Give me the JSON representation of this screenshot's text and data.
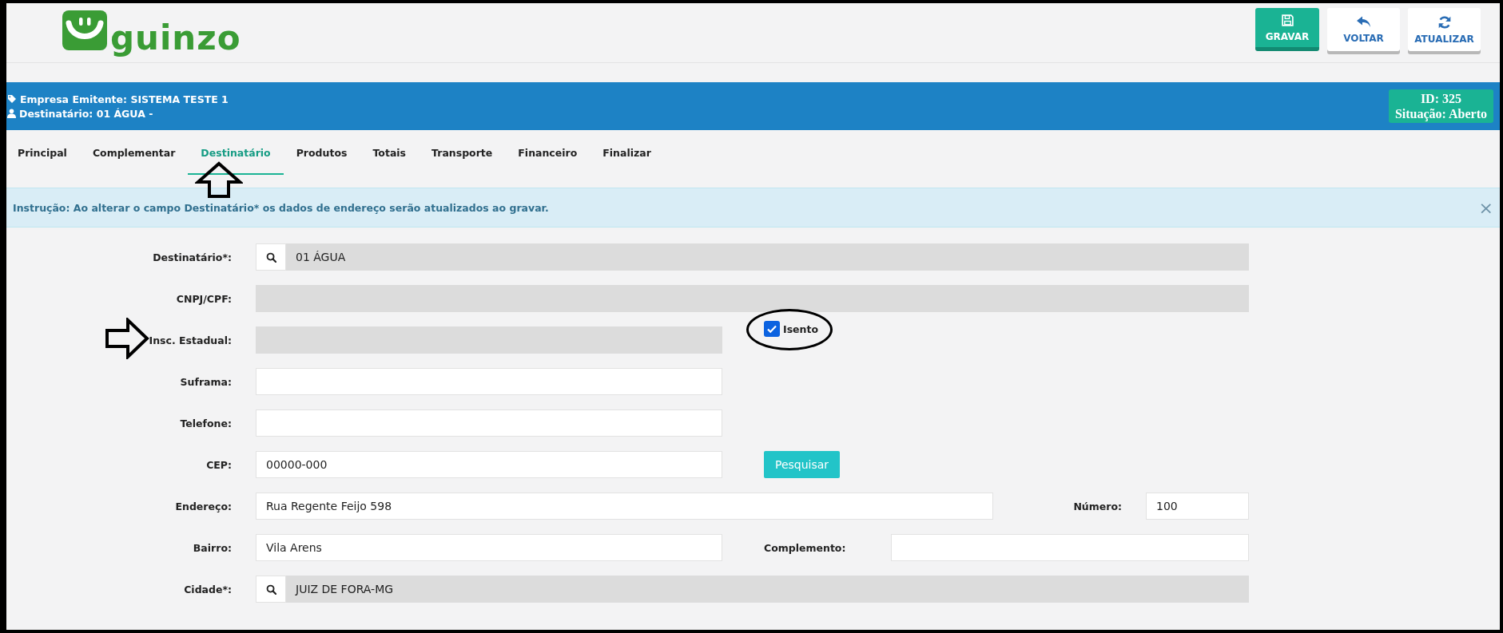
{
  "header": {
    "logo_text": "guinzo",
    "buttons": [
      {
        "label": "GRAVAR",
        "kind": "save",
        "primary": true
      },
      {
        "label": "VOLTAR",
        "kind": "back",
        "primary": false
      },
      {
        "label": "ATUALIZAR",
        "kind": "refresh",
        "primary": false
      }
    ]
  },
  "info_bar": {
    "lines": [
      {
        "kind": "tag",
        "text": "Empresa Emitente: SISTEMA TESTE 1"
      },
      {
        "kind": "user",
        "text": "Destinatário: 01 ÁGUA -"
      }
    ],
    "badge": [
      "ID: 325",
      "Situação: Aberto"
    ]
  },
  "tabs": [
    {
      "label": "Principal",
      "selected": false
    },
    {
      "label": "Complementar",
      "selected": false
    },
    {
      "label": "Destinatário",
      "selected": true
    },
    {
      "label": "Produtos",
      "selected": false
    },
    {
      "label": "Totais",
      "selected": false
    },
    {
      "label": "Transporte",
      "selected": false
    },
    {
      "label": "Financeiro",
      "selected": false
    },
    {
      "label": "Finalizar",
      "selected": false
    }
  ],
  "alert": {
    "text": "Instrução: Ao alterar o campo Destinatário* os dados de endereço serão atualizados ao gravar.",
    "close": "×"
  },
  "form": {
    "rows": [
      {
        "kind": "lookup",
        "label": "Destinatário*:",
        "value": "01 ÁGUA"
      },
      {
        "kind": "readonly",
        "label": "CNPJ/CPF:"
      },
      {
        "kind": "readonly_check",
        "label": "Insc. Estadual:",
        "checkbox": {
          "label": "Isento",
          "checked": true
        }
      },
      {
        "kind": "text",
        "label": "Suframa:"
      },
      {
        "kind": "text",
        "label": "Telefone:"
      },
      {
        "kind": "text_button",
        "label": "CEP:",
        "value": "00000-000",
        "button": "Pesquisar"
      },
      {
        "kind": "address",
        "label": "Endereço:",
        "value": "Rua Regente Feijo 598",
        "second_label": "Número:",
        "second_value": "100"
      },
      {
        "kind": "pair",
        "label": "Bairro:",
        "value": "Vila Arens",
        "second_label": "Complemento:"
      },
      {
        "kind": "lookup",
        "label": "Cidade*:",
        "value": "JUIZ DE FORA-MG"
      }
    ]
  }
}
